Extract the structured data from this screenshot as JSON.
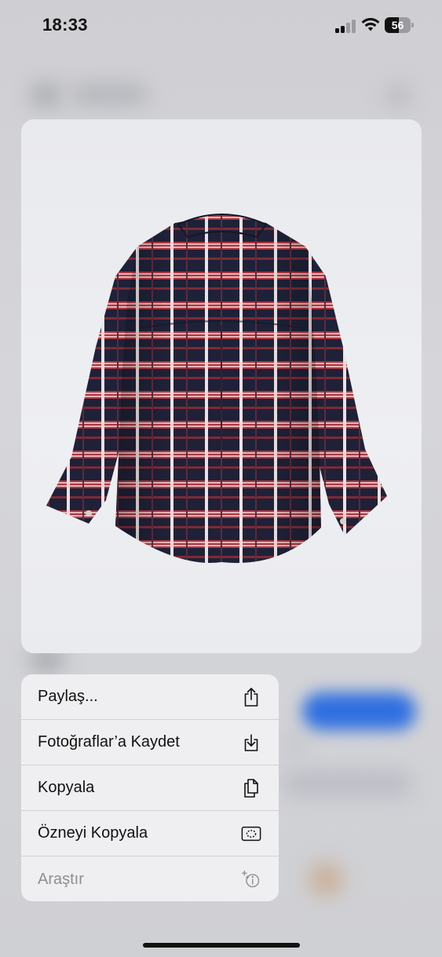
{
  "status_bar": {
    "time": "18:33",
    "battery_level": "56"
  },
  "preview": {
    "subject": "plaid shirt photo",
    "colors": {
      "navy": "#1f2138",
      "red": "#a83844",
      "pink": "#e8b3b4",
      "background": "#ebecf0"
    }
  },
  "menu": {
    "items": [
      {
        "label": "Paylaş...",
        "icon": "share-icon",
        "disabled": false
      },
      {
        "label": "Fotoğraflar’a Kaydet",
        "icon": "save-to-photos-icon",
        "disabled": false
      },
      {
        "label": "Kopyala",
        "icon": "copy-icon",
        "disabled": false
      },
      {
        "label": "Özneyi Kopyala",
        "icon": "copy-subject-icon",
        "disabled": false
      },
      {
        "label": "Araştır",
        "icon": "visual-lookup-icon",
        "disabled": true
      }
    ]
  },
  "colors": {
    "accent_blue": "#2f6fe0",
    "disabled_text": "#8e8e93"
  }
}
